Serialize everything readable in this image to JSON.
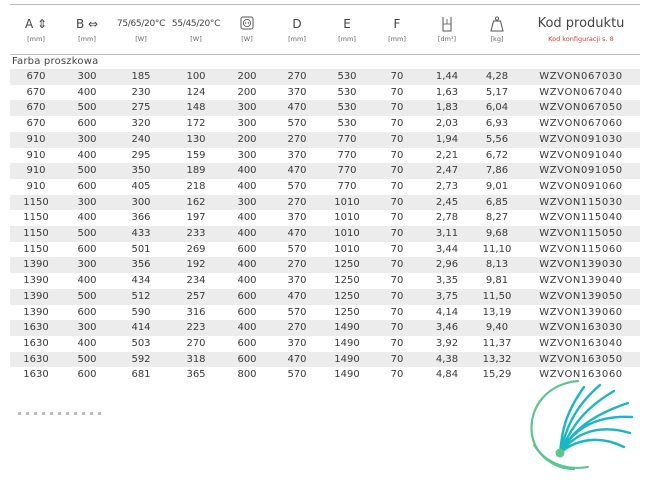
{
  "headers": {
    "a": {
      "label": "A",
      "unit": "[mm]"
    },
    "b": {
      "label": "B",
      "unit": "[mm]"
    },
    "power75": {
      "label": "75/65/20°C",
      "unit": "[W]"
    },
    "power55": {
      "label": "55/45/20°C",
      "unit": "[W]"
    },
    "electric": {
      "unit": "[W]"
    },
    "d": {
      "label": "D",
      "unit": "[mm]"
    },
    "e": {
      "label": "E",
      "unit": "[mm]"
    },
    "f": {
      "label": "F",
      "unit": "[mm]"
    },
    "volume": {
      "unit": "[dm³]"
    },
    "weight": {
      "unit": "[kg]"
    },
    "code": {
      "label": "Kod produktu",
      "note": "Kod konfiguracji s. 8"
    }
  },
  "section_label": "Farba proszkowa",
  "colors": {
    "shade": "#ececec",
    "note": "#d23b3b",
    "logo_teal": "#1bb5c4",
    "logo_green": "#5cc48e"
  },
  "rows": [
    {
      "a": "670",
      "b": "300",
      "p75": "185",
      "p55": "100",
      "el": "200",
      "d": "270",
      "e": "530",
      "f": "70",
      "vol": "1,44",
      "kg": "4,28",
      "code": "WZVON067030"
    },
    {
      "a": "670",
      "b": "400",
      "p75": "230",
      "p55": "124",
      "el": "200",
      "d": "370",
      "e": "530",
      "f": "70",
      "vol": "1,63",
      "kg": "5,17",
      "code": "WZVON067040"
    },
    {
      "a": "670",
      "b": "500",
      "p75": "275",
      "p55": "148",
      "el": "300",
      "d": "470",
      "e": "530",
      "f": "70",
      "vol": "1,83",
      "kg": "6,04",
      "code": "WZVON067050"
    },
    {
      "a": "670",
      "b": "600",
      "p75": "320",
      "p55": "172",
      "el": "300",
      "d": "570",
      "e": "530",
      "f": "70",
      "vol": "2,03",
      "kg": "6,93",
      "code": "WZVON067060"
    },
    {
      "a": "910",
      "b": "300",
      "p75": "240",
      "p55": "130",
      "el": "200",
      "d": "270",
      "e": "770",
      "f": "70",
      "vol": "1,94",
      "kg": "5,56",
      "code": "WZVON091030"
    },
    {
      "a": "910",
      "b": "400",
      "p75": "295",
      "p55": "159",
      "el": "300",
      "d": "370",
      "e": "770",
      "f": "70",
      "vol": "2,21",
      "kg": "6,72",
      "code": "WZVON091040"
    },
    {
      "a": "910",
      "b": "500",
      "p75": "350",
      "p55": "189",
      "el": "400",
      "d": "470",
      "e": "770",
      "f": "70",
      "vol": "2,47",
      "kg": "7,86",
      "code": "WZVON091050"
    },
    {
      "a": "910",
      "b": "600",
      "p75": "405",
      "p55": "218",
      "el": "400",
      "d": "570",
      "e": "770",
      "f": "70",
      "vol": "2,73",
      "kg": "9,01",
      "code": "WZVON091060"
    },
    {
      "a": "1150",
      "b": "300",
      "p75": "300",
      "p55": "162",
      "el": "300",
      "d": "270",
      "e": "1010",
      "f": "70",
      "vol": "2,45",
      "kg": "6,85",
      "code": "WZVON115030"
    },
    {
      "a": "1150",
      "b": "400",
      "p75": "366",
      "p55": "197",
      "el": "400",
      "d": "370",
      "e": "1010",
      "f": "70",
      "vol": "2,78",
      "kg": "8,27",
      "code": "WZVON115040"
    },
    {
      "a": "1150",
      "b": "500",
      "p75": "433",
      "p55": "233",
      "el": "400",
      "d": "470",
      "e": "1010",
      "f": "70",
      "vol": "3,11",
      "kg": "9,68",
      "code": "WZVON115050"
    },
    {
      "a": "1150",
      "b": "600",
      "p75": "501",
      "p55": "269",
      "el": "600",
      "d": "570",
      "e": "1010",
      "f": "70",
      "vol": "3,44",
      "kg": "11,10",
      "code": "WZVON115060"
    },
    {
      "a": "1390",
      "b": "300",
      "p75": "356",
      "p55": "192",
      "el": "400",
      "d": "270",
      "e": "1250",
      "f": "70",
      "vol": "2,96",
      "kg": "8,13",
      "code": "WZVON139030"
    },
    {
      "a": "1390",
      "b": "400",
      "p75": "434",
      "p55": "234",
      "el": "400",
      "d": "370",
      "e": "1250",
      "f": "70",
      "vol": "3,35",
      "kg": "9,81",
      "code": "WZVON139040"
    },
    {
      "a": "1390",
      "b": "500",
      "p75": "512",
      "p55": "257",
      "el": "600",
      "d": "470",
      "e": "1250",
      "f": "70",
      "vol": "3,75",
      "kg": "11,50",
      "code": "WZVON139050"
    },
    {
      "a": "1390",
      "b": "600",
      "p75": "590",
      "p55": "316",
      "el": "600",
      "d": "570",
      "e": "1250",
      "f": "70",
      "vol": "4,14",
      "kg": "13,19",
      "code": "WZVON139060"
    },
    {
      "a": "1630",
      "b": "300",
      "p75": "414",
      "p55": "223",
      "el": "400",
      "d": "270",
      "e": "1490",
      "f": "70",
      "vol": "3,46",
      "kg": "9,40",
      "code": "WZVON163030"
    },
    {
      "a": "1630",
      "b": "400",
      "p75": "503",
      "p55": "270",
      "el": "600",
      "d": "370",
      "e": "1490",
      "f": "70",
      "vol": "3,92",
      "kg": "11,37",
      "code": "WZVON163040"
    },
    {
      "a": "1630",
      "b": "500",
      "p75": "592",
      "p55": "318",
      "el": "600",
      "d": "470",
      "e": "1490",
      "f": "70",
      "vol": "4,38",
      "kg": "13,32",
      "code": "WZVON163050"
    },
    {
      "a": "1630",
      "b": "600",
      "p75": "681",
      "p55": "365",
      "el": "800",
      "d": "570",
      "e": "1490",
      "f": "70",
      "vol": "4,84",
      "kg": "15,29",
      "code": "WZVON163060"
    }
  ]
}
